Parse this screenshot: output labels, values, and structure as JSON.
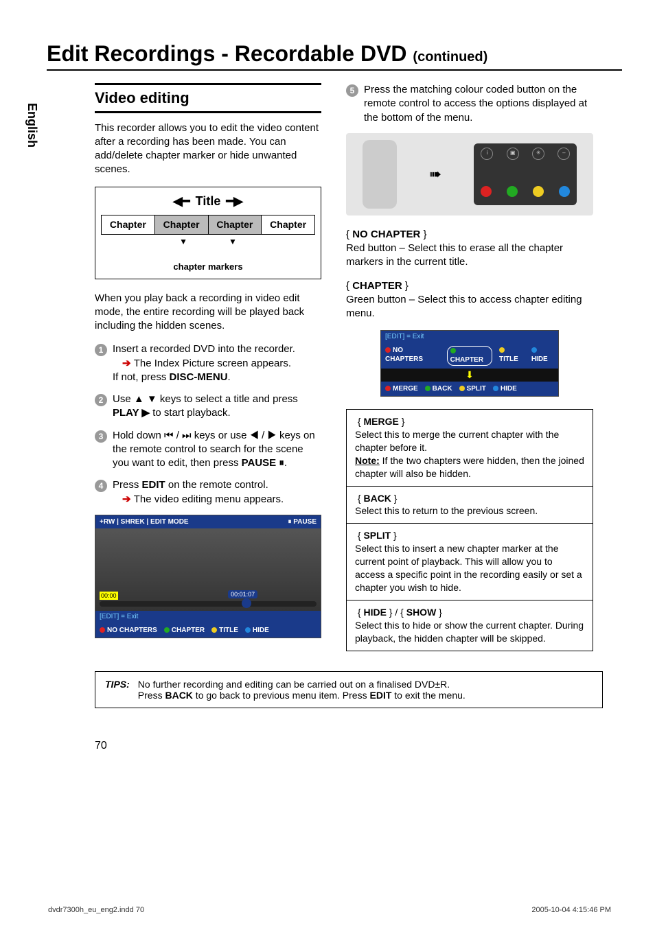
{
  "side_tab": "English",
  "title_main": "Edit Recordings - Recordable DVD ",
  "title_cont": "(continued)",
  "section_head": "Video editing",
  "intro": "This recorder allows you to edit the video content after a recording has been made. You can add/delete chapter marker or hide unwanted scenes.",
  "diagram": {
    "title_label": "Title",
    "chapters": [
      "Chapter",
      "Chapter",
      "Chapter",
      "Chapter"
    ],
    "markers_label": "chapter markers"
  },
  "after_diagram": "When you play back a recording in video edit mode, the entire recording will be played back including the hidden scenes.",
  "steps": [
    {
      "n": "1",
      "text": "Insert a recorded DVD into the recorder.",
      "sub": "The Index Picture screen appears.",
      "sub2_pre": "If not, press ",
      "sub2_b": "DISC-MENU",
      "sub2_post": "."
    },
    {
      "n": "2",
      "pre": "Use ▲ ▼ keys to select a title and press ",
      "b": "PLAY ▶",
      "post": " to start playback."
    },
    {
      "n": "3",
      "pre": "Hold down ⏮ / ⏭ keys or use ◀ / ▶ keys on the remote control to search for the scene you want to edit, then press ",
      "b": "PAUSE ⏸",
      "post": "."
    },
    {
      "n": "4",
      "pre": "Press ",
      "b": "EDIT",
      "post": " on the remote control.",
      "sub": "The video editing menu appears."
    },
    {
      "n": "5",
      "text": "Press the matching colour coded button on the remote control to access the options displayed at the bottom of the menu."
    }
  ],
  "osd": {
    "topbar_left": "+RW | SHREK | EDIT MODE",
    "topbar_right": "⏸ PAUSE",
    "time_start": "00:00",
    "time_mid": "00:01:07",
    "edit_line": "[EDIT] = Exit",
    "items": [
      "NO CHAPTERS",
      "CHAPTER",
      "TITLE",
      "HIDE"
    ]
  },
  "remote_labels": [
    "INFO",
    "SYSTEM",
    "MUTE",
    "TV VOL"
  ],
  "no_chapter": {
    "label": "NO CHAPTER",
    "text": "Red button – Select this to erase all the chapter markers in the current title."
  },
  "chapter": {
    "label": "CHAPTER",
    "text": "Green button – Select this to access chapter editing menu."
  },
  "osd_small": {
    "edit_line": "[EDIT] = Exit",
    "row1": [
      "NO CHAPTERS",
      "CHAPTER",
      "TITLE",
      "HIDE"
    ],
    "row2": [
      "MERGE",
      "BACK",
      "SPLIT",
      "HIDE"
    ]
  },
  "defs": {
    "merge": {
      "label": "MERGE",
      "text": "Select this to merge the current chapter with the chapter before it.",
      "note_label": "Note:",
      "note_text": " If the two chapters were hidden, then the joined chapter will also be hidden."
    },
    "back": {
      "label": "BACK",
      "text": "Select this to return to the previous screen."
    },
    "split": {
      "label": "SPLIT",
      "text": "Select this to insert a new chapter marker at the current point of playback. This will allow you to access a specific point in the recording easily or set a chapter you wish to hide."
    },
    "hideshow": {
      "label1": "HIDE",
      "sep": " } / { ",
      "label2": "SHOW",
      "text": "Select this to hide or show the current chapter. During playback, the hidden chapter will be skipped."
    }
  },
  "tips": {
    "label": "TIPS:",
    "line1_pre": "No further recording and editing can be carried out on a finalised DVD±R.",
    "line2_pre": "Press ",
    "line2_b1": "BACK",
    "line2_mid": " to go back to previous menu item. Press ",
    "line2_b2": "EDIT",
    "line2_post": " to exit the menu."
  },
  "page_num": "70",
  "footer": {
    "left": "dvdr7300h_eu_eng2.indd   70",
    "right": "2005-10-04   4:15:46 PM"
  }
}
